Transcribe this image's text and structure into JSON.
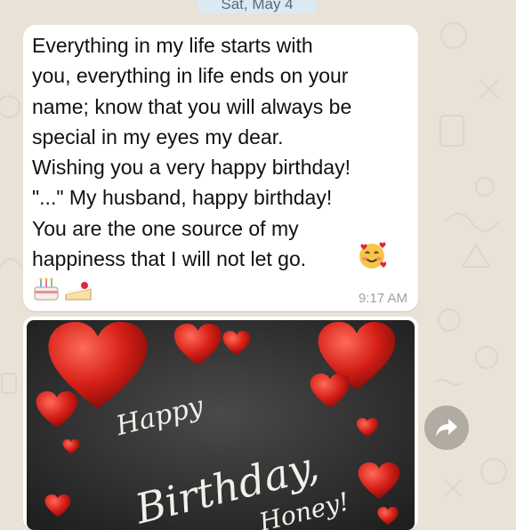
{
  "chat": {
    "date_chip": "Sat, May 4",
    "message": {
      "text": "Everything in my life starts with\nyou, everything in life ends on your\nname; know that you will always be\nspecial in my eyes my dear.\nWishing you a very happy birthday!\n\"...\" My husband, happy birthday!\nYou are the one source of my\nhappiness that I will not let go.",
      "time": "9:17 AM",
      "emojis": [
        "smiling-face-with-hearts",
        "birthday-cake",
        "shortcake"
      ]
    },
    "image": {
      "line1": "Happy",
      "line2": "Birthday,",
      "line3": "Honey!"
    },
    "forward_icon": "forward-icon"
  },
  "colors": {
    "background": "#e9e2d7",
    "bubble": "#ffffff",
    "date_chip": "#dbe9f2",
    "time_text": "#9aa3a8",
    "heart_red": "#d8231b",
    "chalkboard": "#2a2a2a"
  }
}
